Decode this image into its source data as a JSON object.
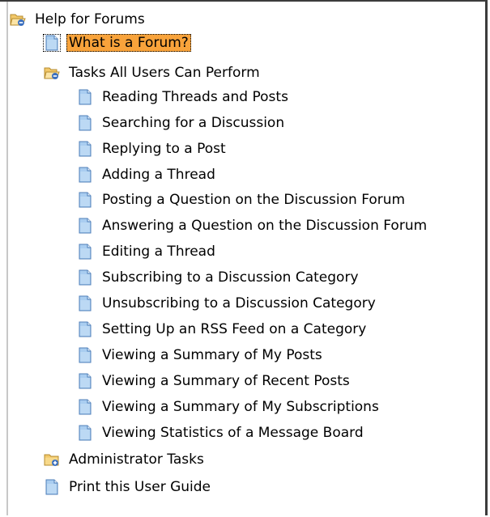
{
  "tree": {
    "root": {
      "label": "Help for Forums",
      "icon": "open-folder-icon"
    },
    "items": [
      {
        "label": "What is a Forum?",
        "icon": "document-icon",
        "selected": true
      },
      {
        "label": "Tasks All Users Can Perform",
        "icon": "open-folder-icon"
      },
      {
        "label": "Reading Threads and Posts",
        "icon": "document-icon"
      },
      {
        "label": "Searching for a Discussion",
        "icon": "document-icon"
      },
      {
        "label": "Replying to a Post",
        "icon": "document-icon"
      },
      {
        "label": "Adding a Thread",
        "icon": "document-icon"
      },
      {
        "label": "Posting a Question on the Discussion Forum",
        "icon": "document-icon"
      },
      {
        "label": "Answering a Question on the Discussion Forum",
        "icon": "document-icon"
      },
      {
        "label": "Editing a Thread",
        "icon": "document-icon"
      },
      {
        "label": "Subscribing to a Discussion Category",
        "icon": "document-icon"
      },
      {
        "label": "Unsubscribing to a Discussion Category",
        "icon": "document-icon"
      },
      {
        "label": "Setting Up an RSS Feed on a Category",
        "icon": "document-icon"
      },
      {
        "label": "Viewing a Summary of My Posts",
        "icon": "document-icon"
      },
      {
        "label": "Viewing a Summary of Recent Posts",
        "icon": "document-icon"
      },
      {
        "label": "Viewing a Summary of My Subscriptions",
        "icon": "document-icon"
      },
      {
        "label": "Viewing Statistics of a Message Board",
        "icon": "document-icon"
      },
      {
        "label": "Administrator Tasks",
        "icon": "closed-folder-icon"
      },
      {
        "label": "Print this User Guide",
        "icon": "document-icon"
      }
    ]
  },
  "colors": {
    "selection": "#f8a33b",
    "folder": "#f2c86a",
    "document": "#a9cdf0"
  }
}
